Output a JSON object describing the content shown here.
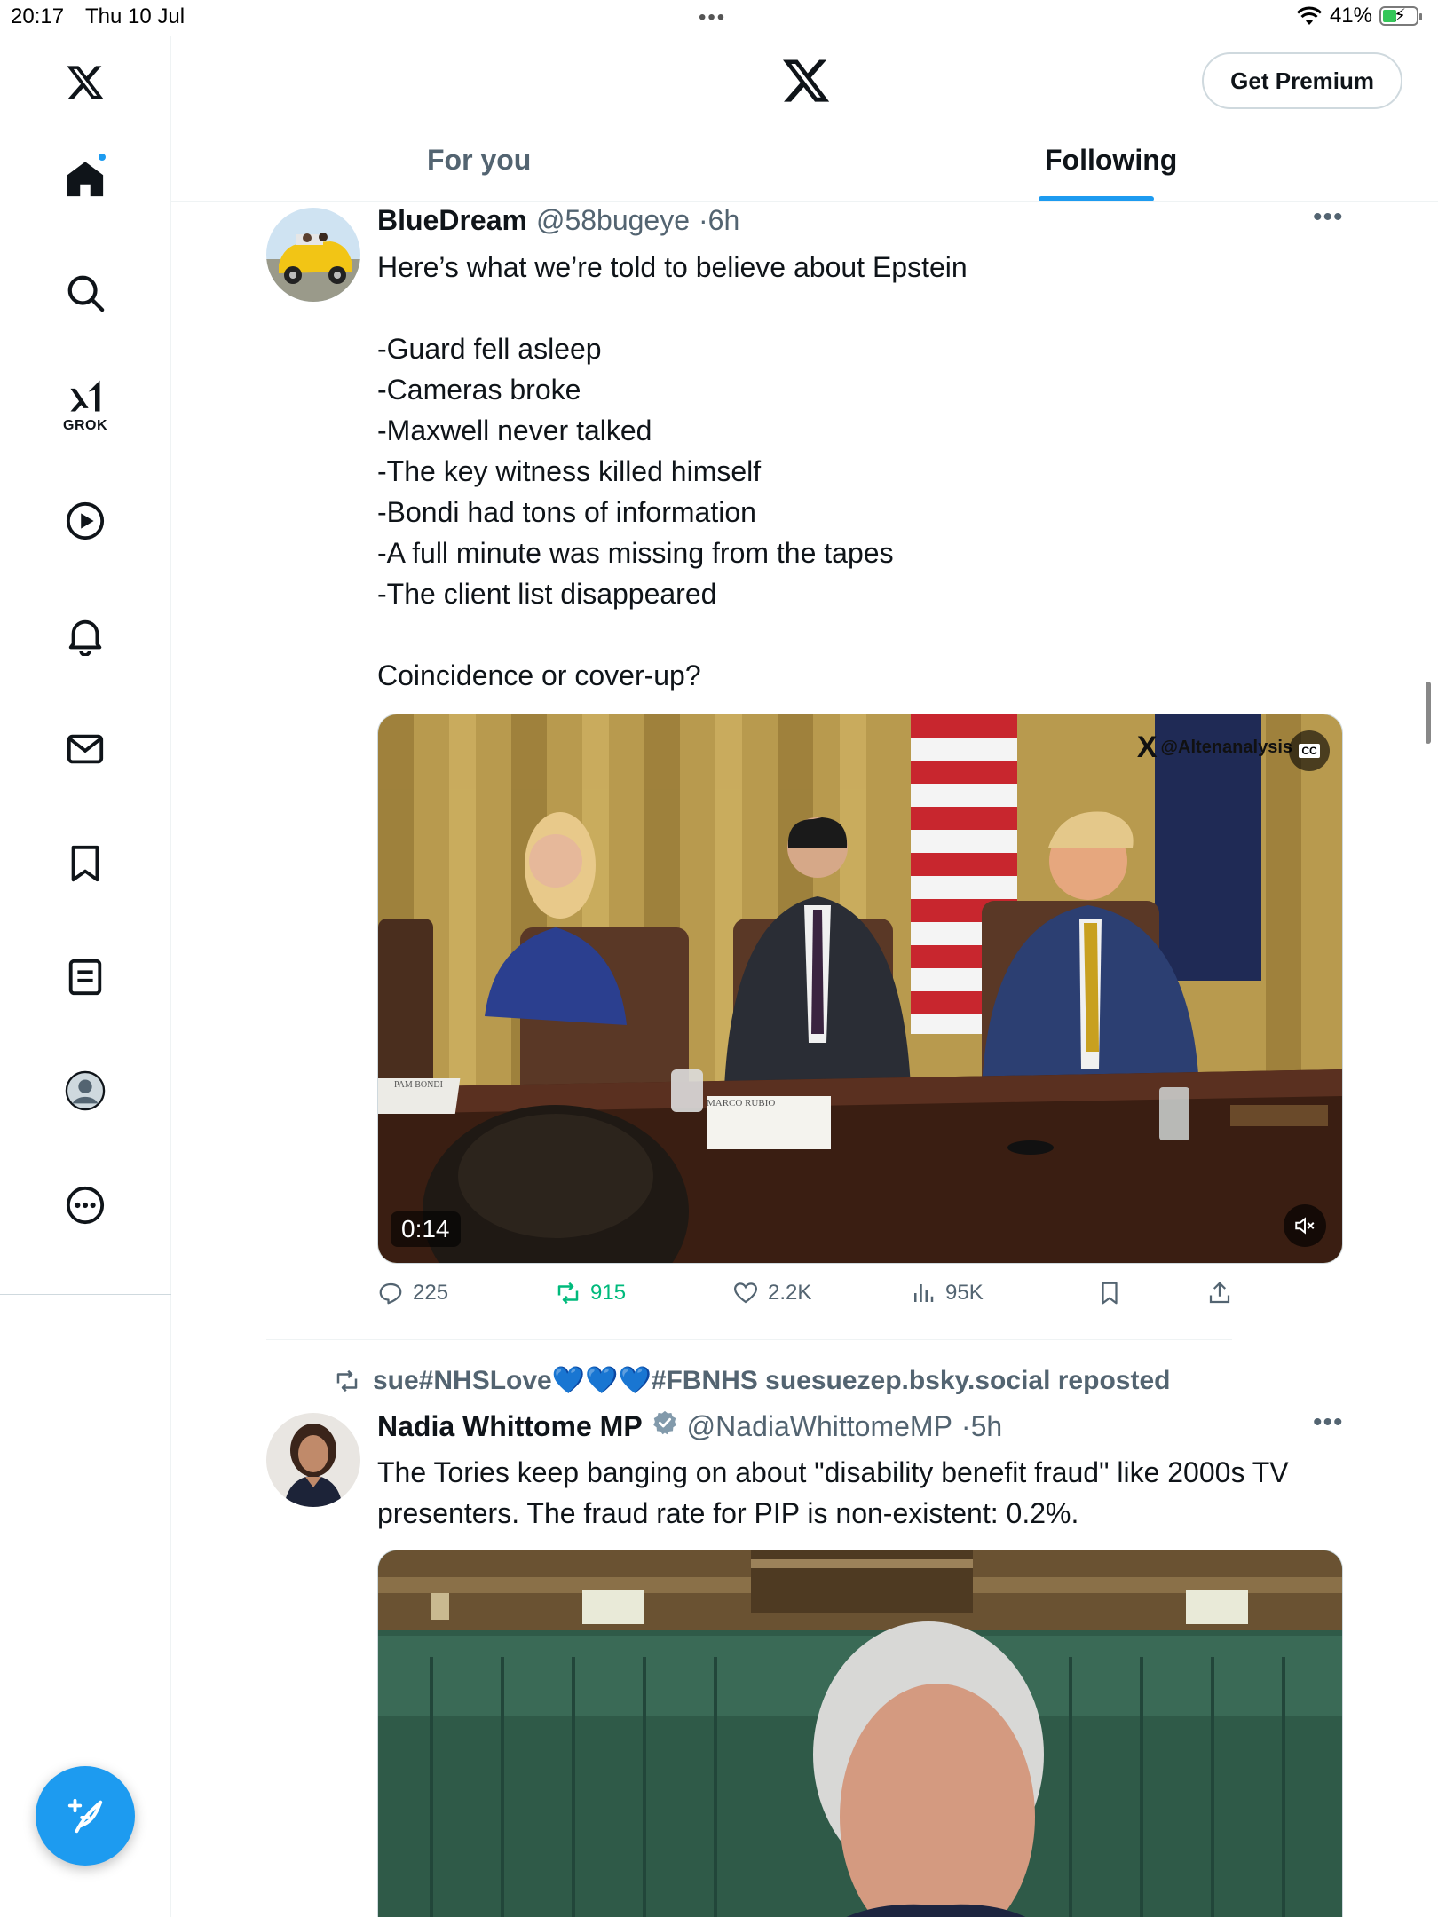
{
  "status_bar": {
    "time": "20:17",
    "date": "Thu 10 Jul",
    "battery": "41%",
    "battery_level": 0.41
  },
  "sidebar": {
    "items": [
      {
        "name": "home",
        "icon": "home-icon",
        "has_badge": true
      },
      {
        "name": "explore",
        "icon": "search-icon"
      },
      {
        "name": "grok",
        "icon": "grok-icon",
        "label": "GROK"
      },
      {
        "name": "videos",
        "icon": "play-icon"
      },
      {
        "name": "notifications",
        "icon": "bell-icon"
      },
      {
        "name": "messages",
        "icon": "mail-icon"
      },
      {
        "name": "bookmarks",
        "icon": "bookmark-icon"
      },
      {
        "name": "lists",
        "icon": "list-icon"
      },
      {
        "name": "profile",
        "icon": "avatar-icon"
      },
      {
        "name": "more",
        "icon": "more-icon"
      }
    ]
  },
  "header": {
    "premium_label": "Get Premium",
    "tabs": [
      {
        "label": "For you",
        "active": false
      },
      {
        "label": "Following",
        "active": true
      }
    ]
  },
  "accent_color": "#1d9bf0",
  "tweets": [
    {
      "name": "BlueDream",
      "handle": "@58bugeye",
      "time": "6h",
      "sep": "·",
      "text": "Here’s what we’re told to believe about Epstein\n\n-Guard fell asleep\n-Cameras broke\n-Maxwell never talked\n-The key witness killed himself\n-Bondi had tons of information\n-A full minute was missing from the tapes\n-The client list disappeared\n\nCoincidence or cover-up?",
      "video": {
        "duration": "0:14",
        "watermark": "@Altenanalysis",
        "placard_left": "PAM BONDI",
        "placard_right": "MARCO RUBIO"
      },
      "stats": {
        "replies": "225",
        "reposts": "915",
        "likes": "2.2K",
        "views": "95K"
      }
    },
    {
      "reposted_by": "sue#NHSLove💙💙💙#FBNHS suesuezep.bsky.social reposted",
      "name": "Nadia Whittome MP",
      "verified": true,
      "handle": "@NadiaWhittomeMP",
      "time": "5h",
      "sep": "·",
      "text": "The Tories keep banging on about \"disability benefit fraud\" like 2000s TV presenters. The fraud rate for PIP is non-existent: 0.2%."
    }
  ]
}
